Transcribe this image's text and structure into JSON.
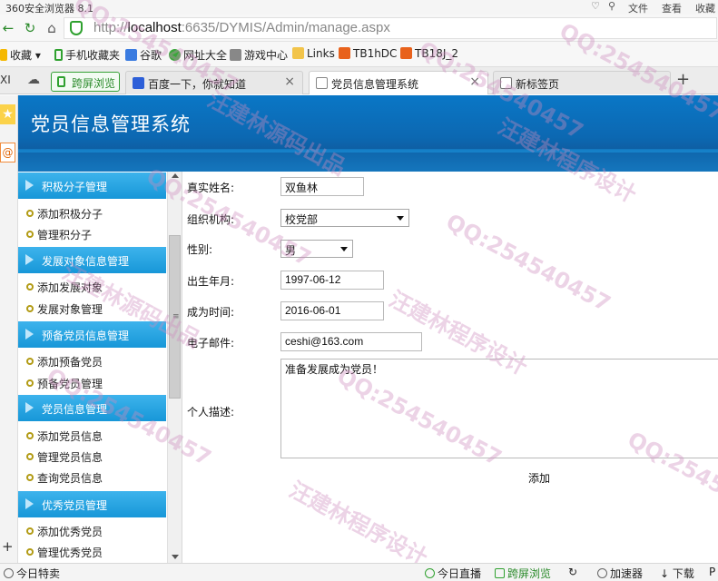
{
  "browser": {
    "app_name": "360安全浏览器 8.1",
    "menus": [
      "文件",
      "查看",
      "收藏"
    ],
    "url_host": "localhost",
    "url_rest": ":6635/DYMIS/Admin/manage.aspx",
    "url_scheme": "http://",
    "bookmarks": [
      "收藏",
      "手机收藏夹",
      "谷歌",
      "网址大全",
      "游戏中心",
      "Links",
      "TB1hDC",
      "TB18J_2"
    ],
    "smart_button": "跨屏浏览",
    "tabs": [
      "百度一下，你就知道",
      "党员信息管理系统",
      "新标签页"
    ],
    "new_tab": "+",
    "status": {
      "left": "今日特卖",
      "live": "今日直播",
      "cross": "跨屏浏览",
      "accelerator": "加速器",
      "download": "下载",
      "end": "P"
    }
  },
  "site": {
    "title": "党员信息管理系统"
  },
  "menu": {
    "groups": [
      {
        "title": "积极分子管理",
        "items": [
          "添加积极分子",
          "管理积分子"
        ]
      },
      {
        "title": "发展对象信息管理",
        "items": [
          "添加发展对象",
          "发展对象管理"
        ]
      },
      {
        "title": "预备党员信息管理",
        "items": [
          "添加预备党员",
          "预备党员管理"
        ]
      },
      {
        "title": "党员信息管理",
        "items": [
          "添加党员信息",
          "管理党员信息",
          "查询党员信息"
        ]
      },
      {
        "title": "优秀党员管理",
        "items": [
          "添加优秀党员",
          "管理优秀党员"
        ]
      }
    ]
  },
  "form": {
    "name_label": "真实姓名:",
    "name_value": "双鱼林",
    "org_label": "组织机构:",
    "org_value": "校党部",
    "gender_label": "性别:",
    "gender_value": "男",
    "birth_label": "出生年月:",
    "birth_value": "1997-06-12",
    "join_label": "成为时间:",
    "join_value": "2016-06-01",
    "email_label": "电子邮件:",
    "email_value": "ceshi@163.com",
    "desc_label": "个人描述:",
    "desc_value": "准备发展成为党员！",
    "submit_label": "添加"
  },
  "watermarks": [
    "QQ:254540457",
    "汪建林源码出品",
    "汪建林程序设计"
  ]
}
